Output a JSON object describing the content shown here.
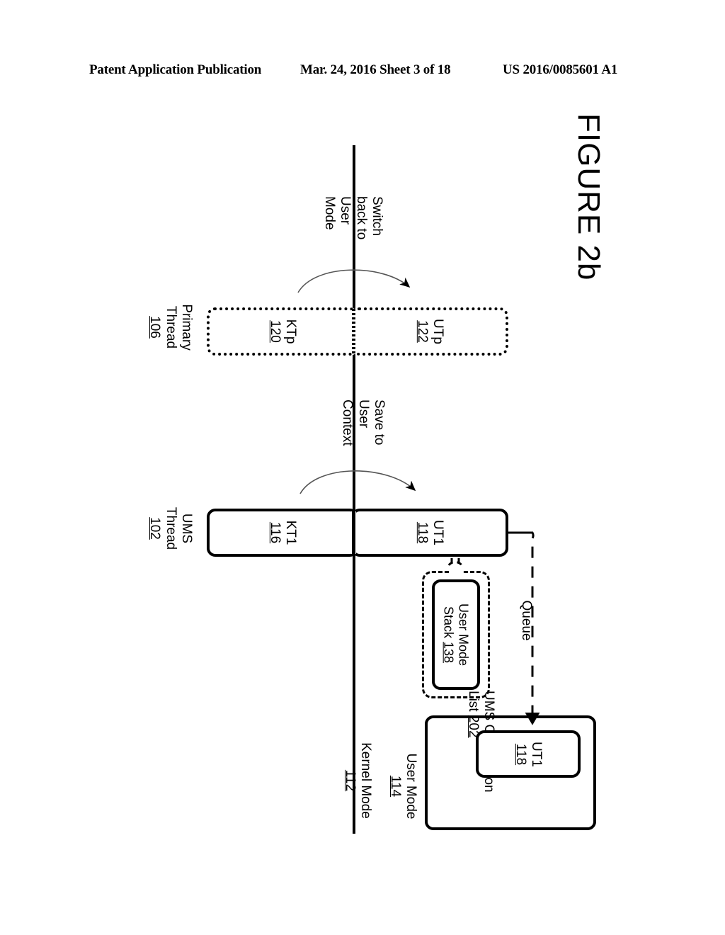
{
  "header": {
    "left": "Patent Application Publication",
    "middle": "Mar. 24, 2016  Sheet 3 of 18",
    "right": "US 2016/0085601 A1"
  },
  "figure": {
    "title": "FIGURE 2b",
    "modes": {
      "kernel_label": "Kernel Mode",
      "kernel_num": "112",
      "user_label": "User Mode",
      "user_num": "114"
    },
    "primary_thread": {
      "label_line1": "Primary",
      "label_line2": "Thread",
      "num": "106",
      "kernel_box": {
        "name": "KTp",
        "num": "120"
      },
      "user_box": {
        "name": "UTp",
        "num": "122"
      }
    },
    "ums_thread": {
      "label_line1": "UMS",
      "label_line2": "Thread",
      "num": "102",
      "kernel_box": {
        "name": "KT1",
        "num": "116"
      },
      "user_box": {
        "name": "UT1",
        "num": "118"
      }
    },
    "user_mode_stack": {
      "line1": "User Mode",
      "line2": "Stack",
      "num": "138"
    },
    "completion_list": {
      "line1": "UMS Completion",
      "line2": "List",
      "num": "202",
      "item": {
        "name": "UT1",
        "num": "118"
      }
    },
    "annotations": {
      "switch_back": [
        "Switch",
        "back to",
        "User",
        "Mode"
      ],
      "save_context": [
        "Save to",
        "User",
        "Context"
      ],
      "queue": "Queue"
    }
  }
}
